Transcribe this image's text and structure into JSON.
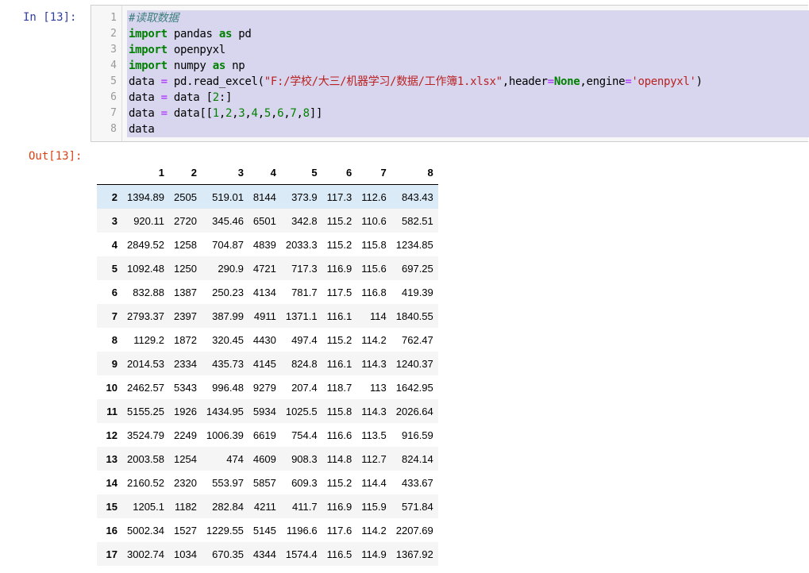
{
  "cell": {
    "in_prompt": "In  [13]:",
    "out_prompt": "Out[13]:",
    "lines": [
      {
        "n": "1",
        "tokens": [
          {
            "t": "#读取数据",
            "c": "cm"
          }
        ]
      },
      {
        "n": "2",
        "tokens": [
          {
            "t": "import",
            "c": "kw"
          },
          {
            "t": " pandas "
          },
          {
            "t": "as",
            "c": "kw"
          },
          {
            "t": " pd"
          }
        ]
      },
      {
        "n": "3",
        "tokens": [
          {
            "t": "import",
            "c": "kw"
          },
          {
            "t": " openpyxl"
          }
        ]
      },
      {
        "n": "4",
        "tokens": [
          {
            "t": "import",
            "c": "kw"
          },
          {
            "t": " numpy "
          },
          {
            "t": "as",
            "c": "kw"
          },
          {
            "t": " np"
          }
        ]
      },
      {
        "n": "5",
        "tokens": [
          {
            "t": "data "
          },
          {
            "t": "=",
            "c": "op"
          },
          {
            "t": " pd.read_excel("
          },
          {
            "t": "\"F:/学校/大三/机器学习/数据/工作簿1.xlsx\"",
            "c": "st"
          },
          {
            "t": ",header"
          },
          {
            "t": "=",
            "c": "op"
          },
          {
            "t": "None",
            "c": "nb"
          },
          {
            "t": ",engine"
          },
          {
            "t": "=",
            "c": "op"
          },
          {
            "t": "'openpyxl'",
            "c": "st"
          },
          {
            "t": ")"
          }
        ]
      },
      {
        "n": "6",
        "tokens": [
          {
            "t": "data "
          },
          {
            "t": "=",
            "c": "op"
          },
          {
            "t": " data ["
          },
          {
            "t": "2",
            "c": "num"
          },
          {
            "t": ":]"
          }
        ]
      },
      {
        "n": "7",
        "tokens": [
          {
            "t": "data "
          },
          {
            "t": "=",
            "c": "op"
          },
          {
            "t": " data[["
          },
          {
            "t": "1",
            "c": "num"
          },
          {
            "t": ","
          },
          {
            "t": "2",
            "c": "num"
          },
          {
            "t": ","
          },
          {
            "t": "3",
            "c": "num"
          },
          {
            "t": ","
          },
          {
            "t": "4",
            "c": "num"
          },
          {
            "t": ","
          },
          {
            "t": "5",
            "c": "num"
          },
          {
            "t": ","
          },
          {
            "t": "6",
            "c": "num"
          },
          {
            "t": ","
          },
          {
            "t": "7",
            "c": "num"
          },
          {
            "t": ","
          },
          {
            "t": "8",
            "c": "num"
          },
          {
            "t": "]]"
          }
        ]
      },
      {
        "n": "8",
        "tokens": [
          {
            "t": "data"
          }
        ]
      }
    ]
  },
  "table": {
    "columns": [
      "",
      "1",
      "2",
      "3",
      "4",
      "5",
      "6",
      "7",
      "8"
    ],
    "rows": [
      [
        "2",
        "1394.89",
        "2505",
        "519.01",
        "8144",
        "373.9",
        "117.3",
        "112.6",
        "843.43"
      ],
      [
        "3",
        "920.11",
        "2720",
        "345.46",
        "6501",
        "342.8",
        "115.2",
        "110.6",
        "582.51"
      ],
      [
        "4",
        "2849.52",
        "1258",
        "704.87",
        "4839",
        "2033.3",
        "115.2",
        "115.8",
        "1234.85"
      ],
      [
        "5",
        "1092.48",
        "1250",
        "290.9",
        "4721",
        "717.3",
        "116.9",
        "115.6",
        "697.25"
      ],
      [
        "6",
        "832.88",
        "1387",
        "250.23",
        "4134",
        "781.7",
        "117.5",
        "116.8",
        "419.39"
      ],
      [
        "7",
        "2793.37",
        "2397",
        "387.99",
        "4911",
        "1371.1",
        "116.1",
        "114",
        "1840.55"
      ],
      [
        "8",
        "1129.2",
        "1872",
        "320.45",
        "4430",
        "497.4",
        "115.2",
        "114.2",
        "762.47"
      ],
      [
        "9",
        "2014.53",
        "2334",
        "435.73",
        "4145",
        "824.8",
        "116.1",
        "114.3",
        "1240.37"
      ],
      [
        "10",
        "2462.57",
        "5343",
        "996.48",
        "9279",
        "207.4",
        "118.7",
        "113",
        "1642.95"
      ],
      [
        "11",
        "5155.25",
        "1926",
        "1434.95",
        "5934",
        "1025.5",
        "115.8",
        "114.3",
        "2026.64"
      ],
      [
        "12",
        "3524.79",
        "2249",
        "1006.39",
        "6619",
        "754.4",
        "116.6",
        "113.5",
        "916.59"
      ],
      [
        "13",
        "2003.58",
        "1254",
        "474",
        "4609",
        "908.3",
        "114.8",
        "112.7",
        "824.14"
      ],
      [
        "14",
        "2160.52",
        "2320",
        "553.97",
        "5857",
        "609.3",
        "115.2",
        "114.4",
        "433.67"
      ],
      [
        "15",
        "1205.1",
        "1182",
        "282.84",
        "4211",
        "411.7",
        "116.9",
        "115.9",
        "571.84"
      ],
      [
        "16",
        "5002.34",
        "1527",
        "1229.55",
        "5145",
        "1196.6",
        "117.6",
        "114.2",
        "2207.69"
      ],
      [
        "17",
        "3002.74",
        "1034",
        "670.35",
        "4344",
        "1574.4",
        "116.5",
        "114.9",
        "1367.92"
      ]
    ],
    "hovered_row_index": 0
  }
}
